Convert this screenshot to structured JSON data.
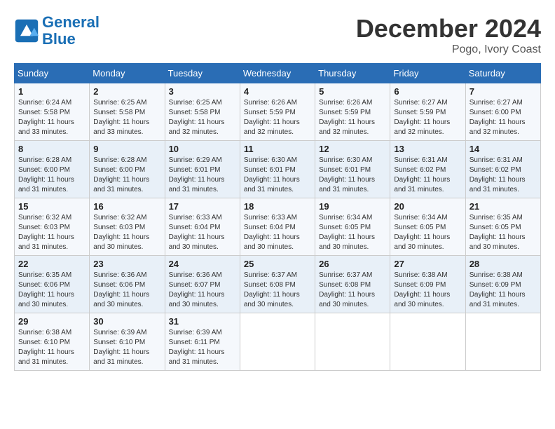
{
  "logo": {
    "line1": "General",
    "line2": "Blue"
  },
  "title": "December 2024",
  "location": "Pogo, Ivory Coast",
  "days_header": [
    "Sunday",
    "Monday",
    "Tuesday",
    "Wednesday",
    "Thursday",
    "Friday",
    "Saturday"
  ],
  "weeks": [
    [
      {
        "day": "1",
        "sunrise": "6:24 AM",
        "sunset": "5:58 PM",
        "daylight": "11 hours and 33 minutes."
      },
      {
        "day": "2",
        "sunrise": "6:25 AM",
        "sunset": "5:58 PM",
        "daylight": "11 hours and 33 minutes."
      },
      {
        "day": "3",
        "sunrise": "6:25 AM",
        "sunset": "5:58 PM",
        "daylight": "11 hours and 32 minutes."
      },
      {
        "day": "4",
        "sunrise": "6:26 AM",
        "sunset": "5:59 PM",
        "daylight": "11 hours and 32 minutes."
      },
      {
        "day": "5",
        "sunrise": "6:26 AM",
        "sunset": "5:59 PM",
        "daylight": "11 hours and 32 minutes."
      },
      {
        "day": "6",
        "sunrise": "6:27 AM",
        "sunset": "5:59 PM",
        "daylight": "11 hours and 32 minutes."
      },
      {
        "day": "7",
        "sunrise": "6:27 AM",
        "sunset": "6:00 PM",
        "daylight": "11 hours and 32 minutes."
      }
    ],
    [
      {
        "day": "8",
        "sunrise": "6:28 AM",
        "sunset": "6:00 PM",
        "daylight": "11 hours and 31 minutes."
      },
      {
        "day": "9",
        "sunrise": "6:28 AM",
        "sunset": "6:00 PM",
        "daylight": "11 hours and 31 minutes."
      },
      {
        "day": "10",
        "sunrise": "6:29 AM",
        "sunset": "6:01 PM",
        "daylight": "11 hours and 31 minutes."
      },
      {
        "day": "11",
        "sunrise": "6:30 AM",
        "sunset": "6:01 PM",
        "daylight": "11 hours and 31 minutes."
      },
      {
        "day": "12",
        "sunrise": "6:30 AM",
        "sunset": "6:01 PM",
        "daylight": "11 hours and 31 minutes."
      },
      {
        "day": "13",
        "sunrise": "6:31 AM",
        "sunset": "6:02 PM",
        "daylight": "11 hours and 31 minutes."
      },
      {
        "day": "14",
        "sunrise": "6:31 AM",
        "sunset": "6:02 PM",
        "daylight": "11 hours and 31 minutes."
      }
    ],
    [
      {
        "day": "15",
        "sunrise": "6:32 AM",
        "sunset": "6:03 PM",
        "daylight": "11 hours and 31 minutes."
      },
      {
        "day": "16",
        "sunrise": "6:32 AM",
        "sunset": "6:03 PM",
        "daylight": "11 hours and 30 minutes."
      },
      {
        "day": "17",
        "sunrise": "6:33 AM",
        "sunset": "6:04 PM",
        "daylight": "11 hours and 30 minutes."
      },
      {
        "day": "18",
        "sunrise": "6:33 AM",
        "sunset": "6:04 PM",
        "daylight": "11 hours and 30 minutes."
      },
      {
        "day": "19",
        "sunrise": "6:34 AM",
        "sunset": "6:05 PM",
        "daylight": "11 hours and 30 minutes."
      },
      {
        "day": "20",
        "sunrise": "6:34 AM",
        "sunset": "6:05 PM",
        "daylight": "11 hours and 30 minutes."
      },
      {
        "day": "21",
        "sunrise": "6:35 AM",
        "sunset": "6:05 PM",
        "daylight": "11 hours and 30 minutes."
      }
    ],
    [
      {
        "day": "22",
        "sunrise": "6:35 AM",
        "sunset": "6:06 PM",
        "daylight": "11 hours and 30 minutes."
      },
      {
        "day": "23",
        "sunrise": "6:36 AM",
        "sunset": "6:06 PM",
        "daylight": "11 hours and 30 minutes."
      },
      {
        "day": "24",
        "sunrise": "6:36 AM",
        "sunset": "6:07 PM",
        "daylight": "11 hours and 30 minutes."
      },
      {
        "day": "25",
        "sunrise": "6:37 AM",
        "sunset": "6:08 PM",
        "daylight": "11 hours and 30 minutes."
      },
      {
        "day": "26",
        "sunrise": "6:37 AM",
        "sunset": "6:08 PM",
        "daylight": "11 hours and 30 minutes."
      },
      {
        "day": "27",
        "sunrise": "6:38 AM",
        "sunset": "6:09 PM",
        "daylight": "11 hours and 30 minutes."
      },
      {
        "day": "28",
        "sunrise": "6:38 AM",
        "sunset": "6:09 PM",
        "daylight": "11 hours and 31 minutes."
      }
    ],
    [
      {
        "day": "29",
        "sunrise": "6:38 AM",
        "sunset": "6:10 PM",
        "daylight": "11 hours and 31 minutes."
      },
      {
        "day": "30",
        "sunrise": "6:39 AM",
        "sunset": "6:10 PM",
        "daylight": "11 hours and 31 minutes."
      },
      {
        "day": "31",
        "sunrise": "6:39 AM",
        "sunset": "6:11 PM",
        "daylight": "11 hours and 31 minutes."
      },
      null,
      null,
      null,
      null
    ]
  ]
}
